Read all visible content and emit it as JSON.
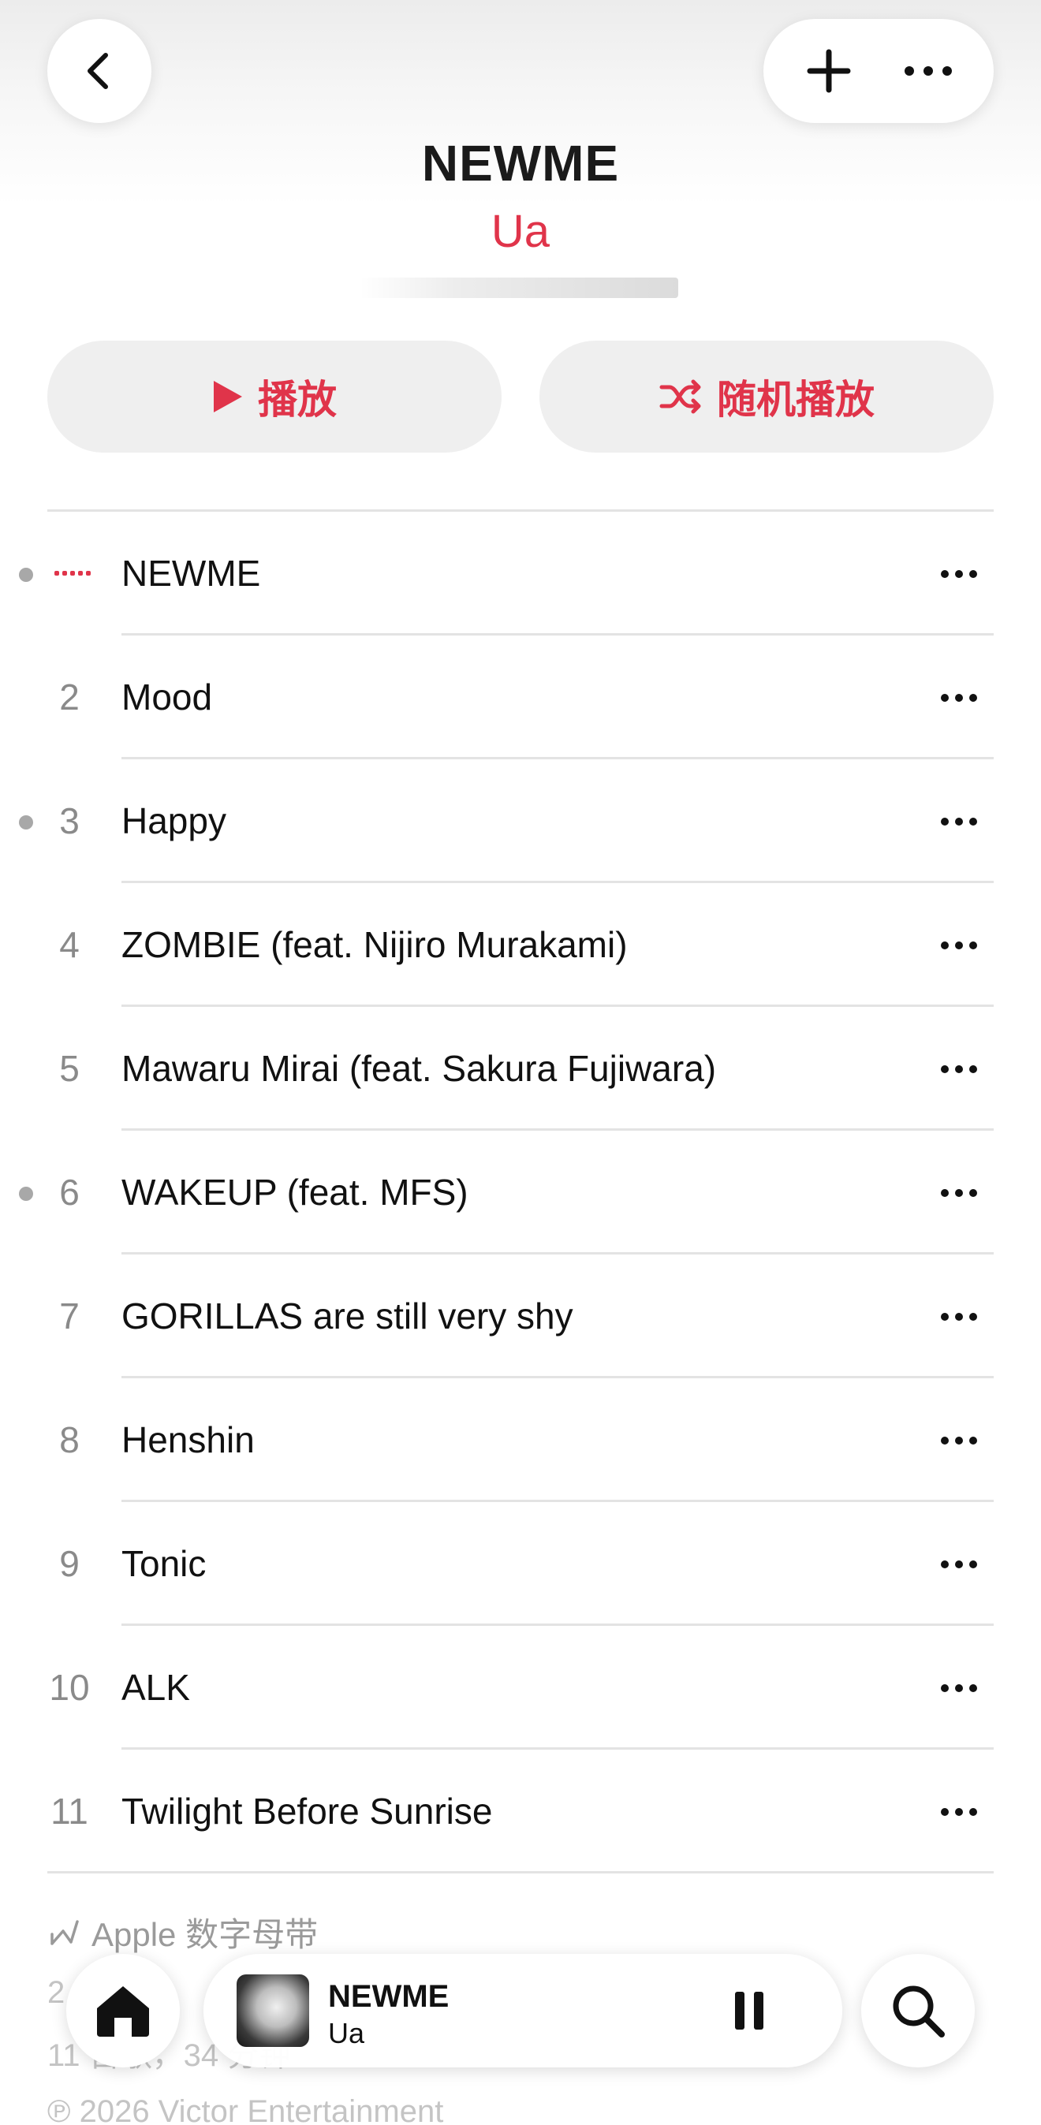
{
  "header": {
    "album_title": "NEWME",
    "artist": "Ua",
    "back_icon": "chevron-left-icon",
    "add_icon": "plus-icon",
    "more_icon": "ellipsis-icon"
  },
  "actions": {
    "play_label": "播放",
    "shuffle_label": "随机播放"
  },
  "tracks": [
    {
      "num": "",
      "title": "NEWME",
      "playing": true,
      "dot": true
    },
    {
      "num": "2",
      "title": "Mood",
      "playing": false,
      "dot": false
    },
    {
      "num": "3",
      "title": "Happy",
      "playing": false,
      "dot": true
    },
    {
      "num": "4",
      "title": "ZOMBIE (feat. Nijiro Murakami)",
      "playing": false,
      "dot": false
    },
    {
      "num": "5",
      "title": "Mawaru Mirai (feat. Sakura Fujiwara)",
      "playing": false,
      "dot": false
    },
    {
      "num": "6",
      "title": "WAKEUP (feat. MFS)",
      "playing": false,
      "dot": true
    },
    {
      "num": "7",
      "title": "GORILLAS are still very shy",
      "playing": false,
      "dot": false
    },
    {
      "num": "8",
      "title": "Henshin",
      "playing": false,
      "dot": false
    },
    {
      "num": "9",
      "title": "Tonic",
      "playing": false,
      "dot": false
    },
    {
      "num": "10",
      "title": "ALK",
      "playing": false,
      "dot": false
    },
    {
      "num": "11",
      "title": "Twilight Before Sunrise",
      "playing": false,
      "dot": false
    }
  ],
  "footer": {
    "lossless_label": "Apple 数字母带",
    "release_line": "2",
    "count_line": "11 首歌，34 分钟",
    "copyright": "℗ 2026 Victor Entertainment"
  },
  "mini_player": {
    "title": "NEWME",
    "artist": "Ua"
  },
  "colors": {
    "accent": "#e0344a",
    "button_bg": "#efefef",
    "divider": "#e3e3e3"
  }
}
